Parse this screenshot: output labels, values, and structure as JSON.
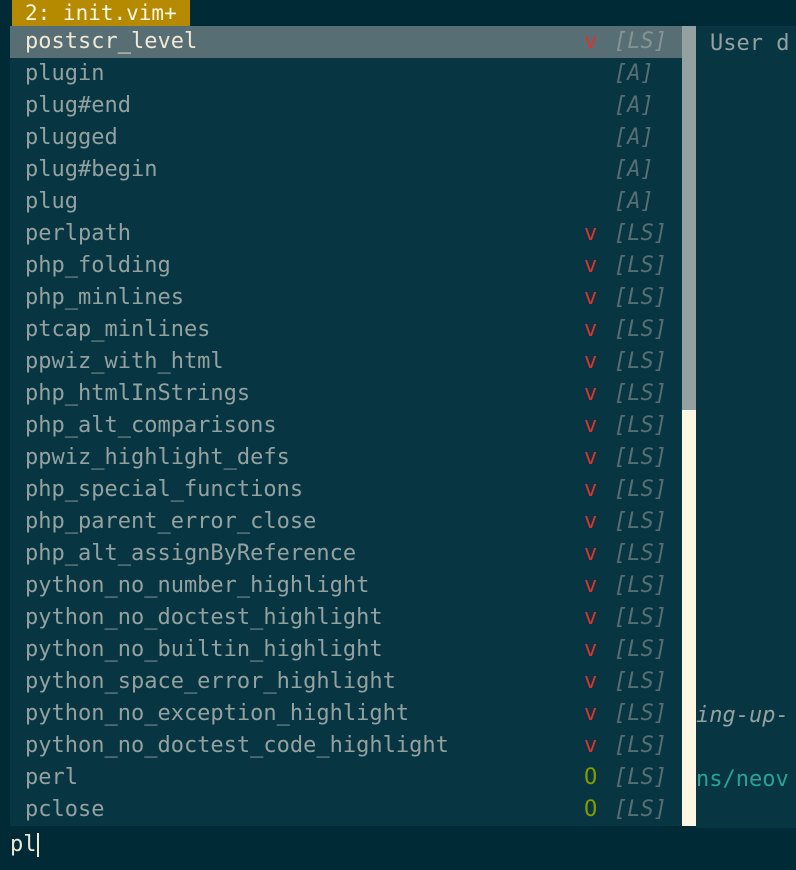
{
  "tabline": {
    "tab_label": "2: init.vim+"
  },
  "right_pane": {
    "line_user": "User d",
    "line_ing": "ing-up-",
    "line_ns": "ns/neov"
  },
  "popup": {
    "items": [
      {
        "word": "postscr_level",
        "kind": "v",
        "menu": "[LS]",
        "selected": true
      },
      {
        "word": "plugin",
        "kind": "",
        "menu": "[A]"
      },
      {
        "word": "plug#end",
        "kind": "",
        "menu": "[A]"
      },
      {
        "word": "plugged",
        "kind": "",
        "menu": "[A]"
      },
      {
        "word": "plug#begin",
        "kind": "",
        "menu": "[A]"
      },
      {
        "word": "plug",
        "kind": "",
        "menu": "[A]"
      },
      {
        "word": "perlpath",
        "kind": "v",
        "menu": "[LS]"
      },
      {
        "word": "php_folding",
        "kind": "v",
        "menu": "[LS]"
      },
      {
        "word": "php_minlines",
        "kind": "v",
        "menu": "[LS]"
      },
      {
        "word": "ptcap_minlines",
        "kind": "v",
        "menu": "[LS]"
      },
      {
        "word": "ppwiz_with_html",
        "kind": "v",
        "menu": "[LS]"
      },
      {
        "word": "php_htmlInStrings",
        "kind": "v",
        "menu": "[LS]"
      },
      {
        "word": "php_alt_comparisons",
        "kind": "v",
        "menu": "[LS]"
      },
      {
        "word": "ppwiz_highlight_defs",
        "kind": "v",
        "menu": "[LS]"
      },
      {
        "word": "php_special_functions",
        "kind": "v",
        "menu": "[LS]"
      },
      {
        "word": "php_parent_error_close",
        "kind": "v",
        "menu": "[LS]"
      },
      {
        "word": "php_alt_assignByReference",
        "kind": "v",
        "menu": "[LS]"
      },
      {
        "word": "python_no_number_highlight",
        "kind": "v",
        "menu": "[LS]"
      },
      {
        "word": "python_no_doctest_highlight",
        "kind": "v",
        "menu": "[LS]"
      },
      {
        "word": "python_no_builtin_highlight",
        "kind": "v",
        "menu": "[LS]"
      },
      {
        "word": "python_space_error_highlight",
        "kind": "v",
        "menu": "[LS]"
      },
      {
        "word": "python_no_exception_highlight",
        "kind": "v",
        "menu": "[LS]"
      },
      {
        "word": "python_no_doctest_code_highlight",
        "kind": "v",
        "menu": "[LS]"
      },
      {
        "word": "perl",
        "kind": "O",
        "menu": "[LS]"
      },
      {
        "word": "pclose",
        "kind": "O",
        "menu": "[LS]"
      }
    ],
    "scrollbar_visible_fraction": 0.48
  },
  "cmdline": {
    "text": "pl"
  },
  "colors": {
    "background": "#002b36",
    "popup_bg": "#073642",
    "selected_bg": "#586e75",
    "tab_bg": "#b58900",
    "kind_v": "#dc322f",
    "kind_O": "#859900"
  }
}
